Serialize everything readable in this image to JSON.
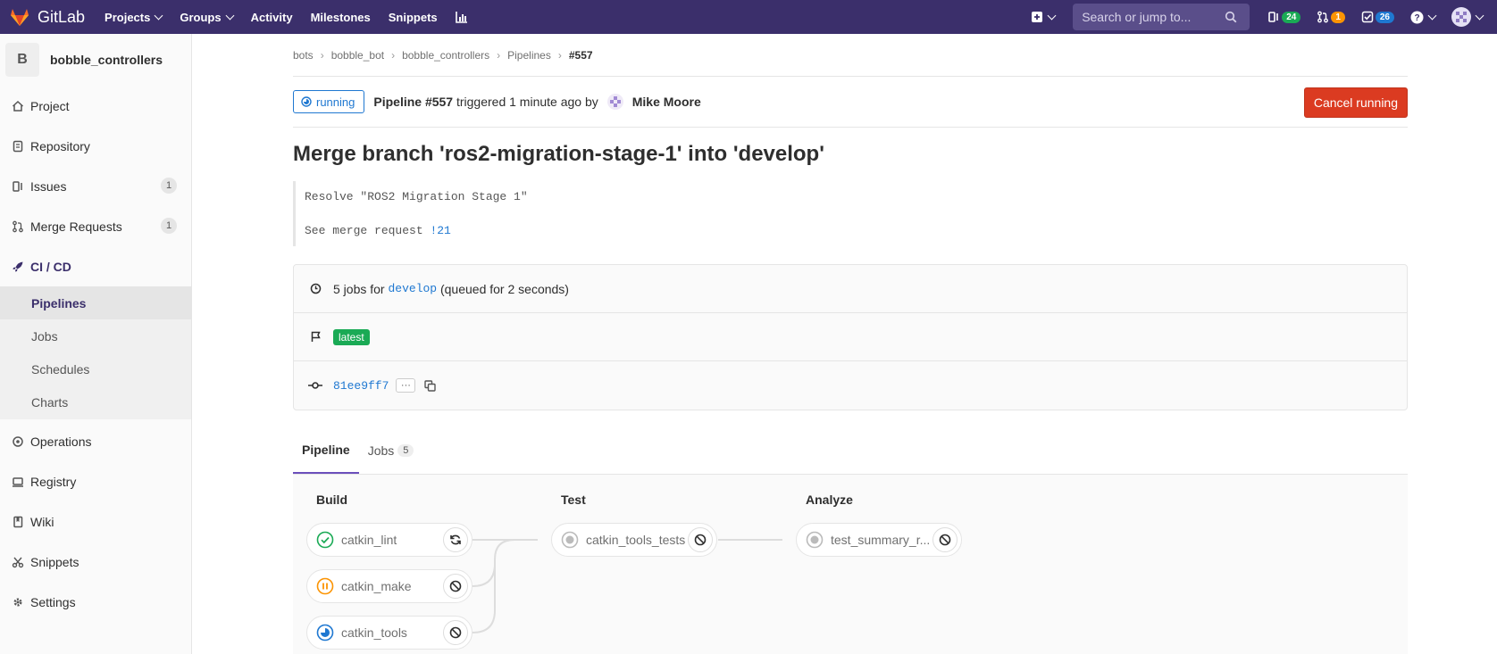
{
  "topnav": {
    "brand": "GitLab",
    "links": [
      "Projects",
      "Groups",
      "Activity",
      "Milestones",
      "Snippets"
    ],
    "search_placeholder": "Search or jump to...",
    "issues_count": "24",
    "mr_count": "1",
    "todos_count": "26"
  },
  "sidebar": {
    "project_initial": "B",
    "project_name": "bobble_controllers",
    "items": [
      {
        "label": "Project"
      },
      {
        "label": "Repository"
      },
      {
        "label": "Issues",
        "count": "1"
      },
      {
        "label": "Merge Requests",
        "count": "1"
      },
      {
        "label": "CI / CD"
      }
    ],
    "cicd_sub": [
      "Pipelines",
      "Jobs",
      "Schedules",
      "Charts"
    ],
    "items_after": [
      "Operations",
      "Registry",
      "Wiki",
      "Snippets",
      "Settings"
    ]
  },
  "breadcrumbs": [
    "bots",
    "bobble_bot",
    "bobble_controllers",
    "Pipelines",
    "#557"
  ],
  "pipeline": {
    "status": "running",
    "title": "Pipeline #557",
    "triggered": "triggered 1 minute ago by",
    "user": "Mike Moore",
    "cancel_label": "Cancel running"
  },
  "commit": {
    "title": "Merge branch 'ros2-migration-stage-1' into 'develop'",
    "desc_line1": "Resolve \"ROS2 Migration Stage 1\"",
    "desc_line2_prefix": "See merge request ",
    "desc_mr_link": "!21"
  },
  "info": {
    "jobs_prefix": "5 jobs for",
    "branch": "develop",
    "queued": "(queued for 2 seconds)",
    "badge": "latest",
    "sha": "81ee9ff7",
    "ellipsis": "···"
  },
  "tabs": [
    {
      "label": "Pipeline"
    },
    {
      "label": "Jobs",
      "count": "5"
    }
  ],
  "stages": [
    {
      "title": "Build",
      "jobs": [
        "catkin_lint",
        "catkin_make",
        "catkin_tools"
      ]
    },
    {
      "title": "Test",
      "jobs": [
        "catkin_tools_tests"
      ]
    },
    {
      "title": "Analyze",
      "jobs": [
        "test_summary_r..."
      ]
    }
  ],
  "colors": {
    "nav_bg": "#3b2f6b",
    "success": "#1aaa55",
    "warning": "#fc9403",
    "running": "#1f78d1",
    "danger": "#db3b21"
  }
}
